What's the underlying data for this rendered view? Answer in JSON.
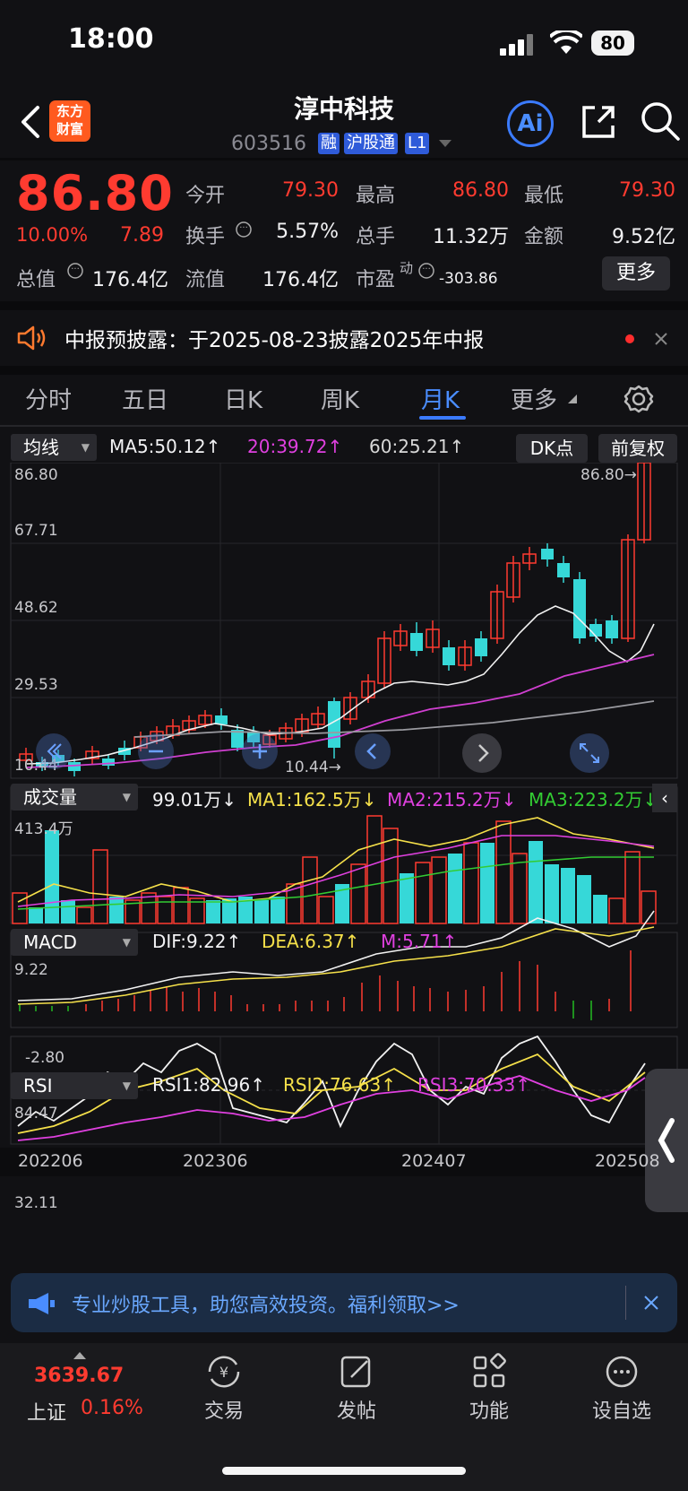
{
  "status_bar": {
    "time": "18:00",
    "battery": "80"
  },
  "header": {
    "logo_line1": "东方",
    "logo_line2": "财富",
    "stock_name": "淳中科技",
    "stock_code": "603516",
    "tags": [
      "融",
      "沪股通",
      "L1"
    ],
    "ai_label": "Ai",
    "icons": [
      "back-icon",
      "share-icon",
      "search-icon"
    ]
  },
  "quote": {
    "price": "86.80",
    "change_pct": "10.00%",
    "change_amt": "7.89",
    "fields": {
      "open_label": "今开",
      "open": "79.30",
      "high_label": "最高",
      "high": "86.80",
      "low_label": "最低",
      "low": "79.30",
      "turnover_label": "换手",
      "turnover": "5.57%",
      "volume_label": "总手",
      "volume": "11.32万",
      "amount_label": "金额",
      "amount": "9.52亿",
      "mktcap_label": "总值",
      "mktcap": "176.4亿",
      "float_label": "流值",
      "float": "176.4亿",
      "pe_label": "市盈",
      "pe_sup": "动",
      "pe": "-303.86"
    },
    "more_label": "更多"
  },
  "notice": {
    "text": "中报预披露：于2025-08-23披露2025年中报"
  },
  "tabs": [
    "分时",
    "五日",
    "日K",
    "周K",
    "月K",
    "更多"
  ],
  "active_tab": "月K",
  "kline": {
    "selector": "均线",
    "ma5": "MA5:50.12↑",
    "ma20": "20:39.72↑",
    "ma60": "60:25.21↑",
    "dk_button": "DK点",
    "adjust_button": "前复权",
    "axis_labels": [
      "86.80",
      "67.71",
      "48.62",
      "29.53",
      "10.44"
    ],
    "max_marker": "86.80→",
    "min_marker": "10.44→"
  },
  "volume": {
    "selector": "成交量",
    "value": "99.01万↓",
    "ma1": "MA1:162.5万↓",
    "ma2": "MA2:215.2万↓",
    "ma3": "MA3:223.2万↓",
    "axis_top": "413.4万"
  },
  "macd": {
    "selector": "MACD",
    "dif": "DIF:9.22↑",
    "dea": "DEA:6.37↑",
    "m": "M:5.71↑",
    "axis_top": "9.22",
    "axis_bottom": "-2.80"
  },
  "rsi": {
    "selector": "RSI",
    "rsi1": "RSI1:82.96↑",
    "rsi2": "RSI2:76.63↑",
    "rsi3": "RSI3:70.33↑",
    "axis_top": "84.47",
    "axis_bottom": "32.11"
  },
  "x_axis": [
    "202206",
    "202306",
    "202407",
    "202508"
  ],
  "banner": {
    "text": "专业炒股工具，助您高效投资。福利领取>>"
  },
  "bottom_nav": {
    "index_value": "3639.67",
    "index_name": "上证",
    "index_change": "0.16%",
    "items": [
      "交易",
      "发帖",
      "功能",
      "设自选"
    ]
  },
  "colors": {
    "up": "#ff3b30",
    "down": "#36d8d8",
    "accent": "#3b7bff",
    "bg": "#111114"
  }
}
